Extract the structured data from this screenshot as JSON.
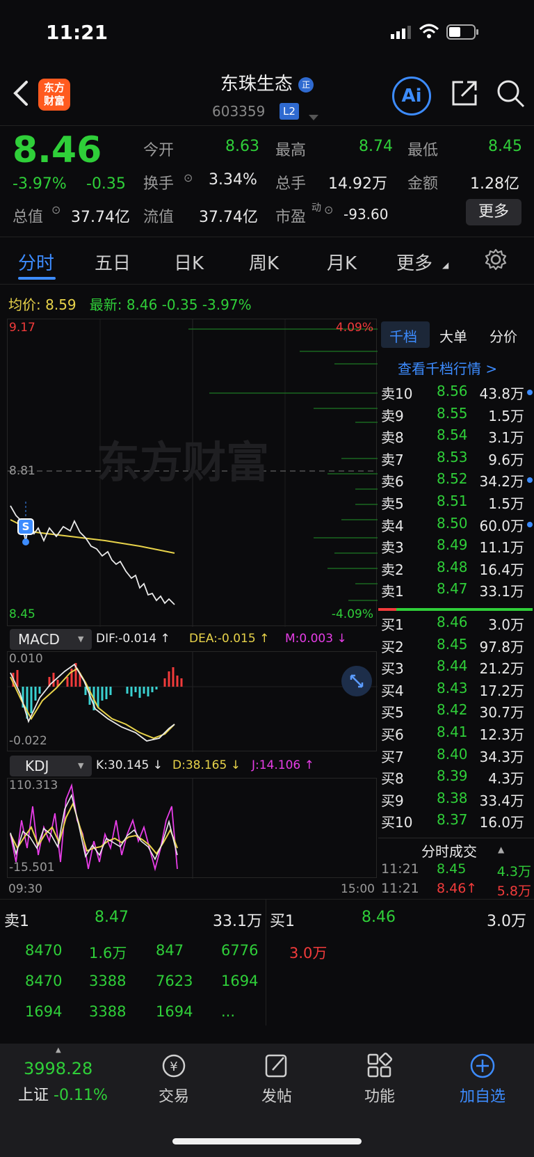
{
  "status": {
    "time": "11:21"
  },
  "header": {
    "logo_line1": "东方",
    "logo_line2": "财富",
    "stock_name": "东珠生态",
    "name_badge": "正",
    "stock_code": "603359",
    "level_badge": "L2",
    "ai_label": "Ai"
  },
  "quote": {
    "price": "8.46",
    "change_pct": "-3.97%",
    "change": "-0.35",
    "open_label": "今开",
    "open": "8.63",
    "high_label": "最高",
    "high": "8.74",
    "low_label": "最低",
    "low": "8.45",
    "turnover_label": "换手",
    "turnover": "3.34%",
    "volume_label": "总手",
    "volume": "14.92万",
    "amount_label": "金额",
    "amount": "1.28亿",
    "mktcap_label": "总值",
    "mktcap": "37.74亿",
    "float_label": "流值",
    "float": "37.74亿",
    "pe_label": "市盈",
    "pe_sup": "动",
    "pe": "-93.60",
    "more_label": "更多"
  },
  "tabs": [
    "分时",
    "五日",
    "日K",
    "周K",
    "月K",
    "更多"
  ],
  "avg_bar": {
    "avg_label": "均价:",
    "avg": "8.59",
    "last_label": "最新:",
    "last": "8.46",
    "chg": "-0.35",
    "pct": "-3.97%"
  },
  "chart": {
    "y_top": "9.17",
    "y_mid": "8.81",
    "y_bottom": "8.45",
    "pct_top": "4.09%",
    "pct_bottom": "-4.09%",
    "watermark": "东方财富",
    "signal_badge": "S",
    "time_start": "09:30",
    "time_end": "15:00"
  },
  "macd": {
    "name": "MACD",
    "dif": "DIF:-0.014 ↑",
    "dea": "DEA:-0.015 ↑",
    "m": "M:0.003 ↓",
    "y_top": "0.010",
    "y_bottom": "-0.022"
  },
  "kdj": {
    "name": "KDJ",
    "k": "K:30.145 ↓",
    "d": "D:38.165 ↓",
    "j": "J:14.106 ↑",
    "y_top": "110.313",
    "y_bottom": "-15.501"
  },
  "orderbook": {
    "tabs": [
      "千档",
      "大单",
      "分价"
    ],
    "link": "查看千档行情 >",
    "asks": [
      {
        "label": "卖10",
        "price": "8.56",
        "vol": "43.8万",
        "dot": true
      },
      {
        "label": "卖9",
        "price": "8.55",
        "vol": "1.5万",
        "dot": false
      },
      {
        "label": "卖8",
        "price": "8.54",
        "vol": "3.1万",
        "dot": false
      },
      {
        "label": "卖7",
        "price": "8.53",
        "vol": "9.6万",
        "dot": false
      },
      {
        "label": "卖6",
        "price": "8.52",
        "vol": "34.2万",
        "dot": true
      },
      {
        "label": "卖5",
        "price": "8.51",
        "vol": "1.5万",
        "dot": false
      },
      {
        "label": "卖4",
        "price": "8.50",
        "vol": "60.0万",
        "dot": true
      },
      {
        "label": "卖3",
        "price": "8.49",
        "vol": "11.1万",
        "dot": false
      },
      {
        "label": "卖2",
        "price": "8.48",
        "vol": "16.4万",
        "dot": false
      },
      {
        "label": "卖1",
        "price": "8.47",
        "vol": "33.1万",
        "dot": false
      }
    ],
    "bids": [
      {
        "label": "买1",
        "price": "8.46",
        "vol": "3.0万"
      },
      {
        "label": "买2",
        "price": "8.45",
        "vol": "97.8万"
      },
      {
        "label": "买3",
        "price": "8.44",
        "vol": "21.2万"
      },
      {
        "label": "买4",
        "price": "8.43",
        "vol": "17.2万"
      },
      {
        "label": "买5",
        "price": "8.42",
        "vol": "30.7万"
      },
      {
        "label": "买6",
        "price": "8.41",
        "vol": "12.3万"
      },
      {
        "label": "买7",
        "price": "8.40",
        "vol": "34.3万"
      },
      {
        "label": "买8",
        "price": "8.39",
        "vol": "4.3万"
      },
      {
        "label": "买9",
        "price": "8.38",
        "vol": "33.4万"
      },
      {
        "label": "买10",
        "price": "8.37",
        "vol": "16.0万"
      }
    ],
    "ticks_title": "分时成交",
    "ticks": [
      {
        "time": "11:21",
        "price": "8.45",
        "vol": "4.3万"
      },
      {
        "time": "11:21",
        "price": "8.46↑",
        "vol": "5.8万"
      }
    ]
  },
  "queue": {
    "sell_label": "卖1",
    "sell_price": "8.47",
    "sell_vol": "33.1万",
    "buy_label": "买1",
    "buy_price": "8.46",
    "buy_vol": "3.0万",
    "sell_rows": [
      [
        "8470",
        "1.6万",
        "847",
        "6776"
      ],
      [
        "8470",
        "3388",
        "7623",
        "1694"
      ],
      [
        "1694",
        "3388",
        "1694",
        "..."
      ]
    ],
    "buy_first": "3.0万"
  },
  "bottom": {
    "index_value": "3998.28",
    "index_name": "上证",
    "index_pct": "-0.11%",
    "nav": [
      "交易",
      "发帖",
      "功能",
      "加自选"
    ]
  },
  "colors": {
    "up": "#f23b3b",
    "down": "#2fcf39",
    "accent": "#3d8cff",
    "avg": "#e8d34a"
  }
}
